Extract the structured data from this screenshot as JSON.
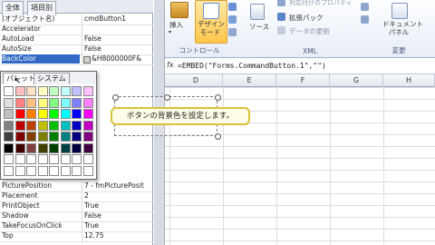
{
  "properties": {
    "tabs": [
      "全体",
      "項目別"
    ],
    "rows_top": [
      {
        "name": "(オブジェクト名)",
        "value": "cmdButton1"
      },
      {
        "name": "Accelerator",
        "value": ""
      },
      {
        "name": "AutoLoad",
        "value": "False"
      },
      {
        "name": "AutoSize",
        "value": "False"
      },
      {
        "name": "BackColor",
        "value": "&H8000000F&"
      }
    ],
    "rows_bottom": [
      {
        "name": "PicturePosition",
        "value": "7 - fmPicturePosit"
      },
      {
        "name": "Placement",
        "value": "2"
      },
      {
        "name": "PrintObject",
        "value": "True"
      },
      {
        "name": "Shadow",
        "value": "False"
      },
      {
        "name": "TakeFocusOnClick",
        "value": "True"
      },
      {
        "name": "Top",
        "value": "12.75"
      }
    ]
  },
  "palette": {
    "tabs": [
      "パレット",
      "システム"
    ],
    "colors": [
      [
        "#ffffff",
        "#ffc0c0",
        "#ffe0c0",
        "#ffffc0",
        "#c0ffc0",
        "#c0ffff",
        "#c0c0ff",
        "#ffc0ff"
      ],
      [
        "#e0e0e0",
        "#ff8080",
        "#ffc080",
        "#ffff80",
        "#80ff80",
        "#80ffff",
        "#8080ff",
        "#ff80ff"
      ],
      [
        "#c0c0c0",
        "#ff0000",
        "#ff8000",
        "#ffff00",
        "#00ff00",
        "#00ffff",
        "#0000ff",
        "#ff00ff"
      ],
      [
        "#808080",
        "#c00000",
        "#c04000",
        "#c0c000",
        "#00c000",
        "#00c0c0",
        "#0000c0",
        "#c000c0"
      ],
      [
        "#404040",
        "#800000",
        "#804000",
        "#808000",
        "#008000",
        "#008080",
        "#000080",
        "#800080"
      ],
      [
        "#000000",
        "#400000",
        "#804040",
        "#404000",
        "#004000",
        "#004040",
        "#000040",
        "#400040"
      ],
      [
        "#ffffff",
        "#ffffff",
        "#ffffff",
        "#ffffff",
        "#ffffff",
        "#ffffff",
        "#ffffff",
        "#ffffff"
      ],
      [
        "#ffffff",
        "#ffffff",
        "#ffffff",
        "#ffffff",
        "#ffffff",
        "#ffffff",
        "#ffffff",
        "#ffffff"
      ]
    ]
  },
  "ribbon": {
    "insert_label": "挿入",
    "design_mode_label": "デザイン\nモード",
    "controls_group": "コントロール",
    "source_label": "ソース",
    "properties_label": "対応付けのプロパティ",
    "expansion_pack_label": "拡張パック",
    "refresh_label": "データの更新",
    "xml_group": "XML",
    "doc_panel_label": "ドキュメント\nパネル",
    "change_group": "変更"
  },
  "formula_bar": {
    "fx": "fx",
    "formula": "=EMBED(\"Forms.CommandButton.1\",\"\")"
  },
  "columns": [
    "D",
    "E",
    "F",
    "G",
    "H"
  ],
  "callout": {
    "text": "ボタンの背景色を設定します。"
  }
}
